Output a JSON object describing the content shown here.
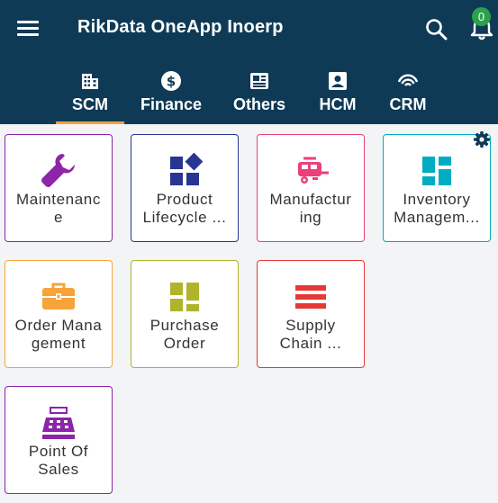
{
  "header": {
    "title": "RikData OneApp Inoerp",
    "notification_count": "0",
    "icons": [
      "menu-icon",
      "search-icon",
      "bell-icon"
    ]
  },
  "tabs": [
    {
      "label": "SCM",
      "icon": "building-icon",
      "active": true
    },
    {
      "label": "Finance",
      "icon": "dollar-icon",
      "active": false
    },
    {
      "label": "Others",
      "icon": "newspaper-icon",
      "active": false
    },
    {
      "label": "HCM",
      "icon": "contact-card-icon",
      "active": false
    },
    {
      "label": "CRM",
      "icon": "signal-arc-icon",
      "active": false
    }
  ],
  "modules": [
    {
      "line1": "Maintenanc",
      "line2": "e",
      "icon": "wrench-icon",
      "color": "#8e24aa"
    },
    {
      "line1": "Product",
      "line2": "Lifecycle ...",
      "icon": "widgets-icon",
      "color": "#283593"
    },
    {
      "line1": "Manufactur",
      "line2": "ing",
      "icon": "rv-trailer-icon",
      "color": "#ec407a"
    },
    {
      "line1": "Inventory",
      "line2": "Managem...",
      "icon": "dashboard-icon",
      "color": "#00acc1"
    },
    {
      "line1": "Order Mana",
      "line2": "gement",
      "icon": "briefcase-icon",
      "color": "#f6a33a"
    },
    {
      "line1": "Purchase",
      "line2": "Order",
      "icon": "grid-blocks-icon",
      "color": "#afb42b"
    },
    {
      "line1": "Supply",
      "line2": "Chain ...",
      "icon": "stacked-bars-icon",
      "color": "#e53935"
    },
    {
      "line1": "Point Of",
      "line2": "Sales",
      "icon": "cash-register-icon",
      "color": "#8e24aa"
    }
  ],
  "settings_icon": "gear-icon",
  "colors": {
    "header_bg": "#0f3a56",
    "tab_indicator": "#f3a13b",
    "badge": "#2aa24a"
  }
}
